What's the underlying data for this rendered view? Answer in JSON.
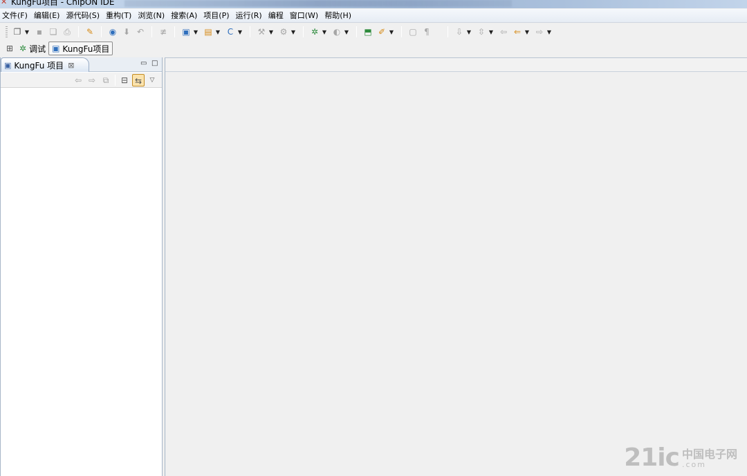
{
  "window": {
    "title": "KungFu项目  -  ChipON IDE"
  },
  "menu": {
    "items": [
      "文件(F)",
      "编辑(E)",
      "源代码(S)",
      "重构(T)",
      "浏览(N)",
      "搜索(A)",
      "项目(P)",
      "运行(R)",
      "编程",
      "窗口(W)",
      "帮助(H)"
    ]
  },
  "toolbar": {
    "icons": [
      "new-icon",
      "save-icon",
      "save-all-icon",
      "print-icon",
      "broom-icon",
      "search-icon",
      "download-icon",
      "undo-icon",
      "format-icon",
      "new-project-icon",
      "open-folder-icon",
      "new-c-file-icon",
      "build-icon",
      "debug-gear-icon",
      "bug-icon",
      "run-icon",
      "program-icon",
      "tool-icon",
      "doc-icon",
      "paragraph-icon",
      "annotation-icon",
      "bookmark-icon",
      "back-icon",
      "prev-icon",
      "next-icon"
    ]
  },
  "perspectives": {
    "debug_label": "调试",
    "project_label": "KungFu项目"
  },
  "left_view": {
    "tab_label": "KungFu 项目"
  },
  "watermark": {
    "main": "21ic",
    "cn": "中国电子网",
    "domain": ".com"
  },
  "colors": {
    "accent": "#2f6fbd",
    "view_border": "#a7b6c8",
    "pressed_toggle": "#fbe3ad"
  }
}
